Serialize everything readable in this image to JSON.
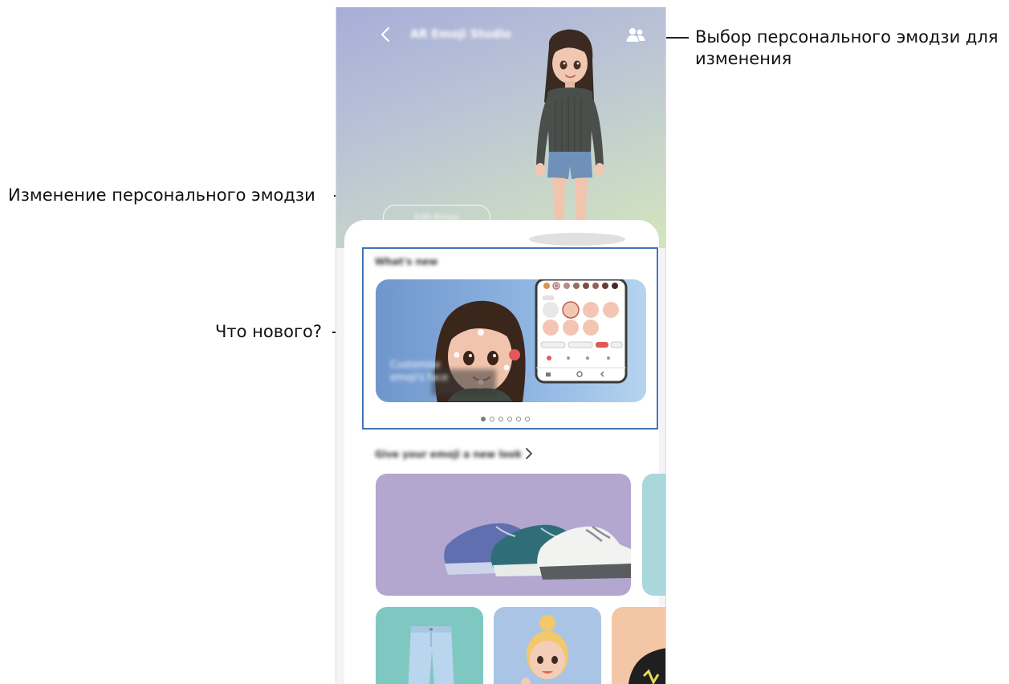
{
  "annotations": {
    "select_emoji_line1": "Выбор персонального эмодзи для",
    "select_emoji_line2": "изменения",
    "edit_emoji": "Изменение персонального эмодзи",
    "whats_new": "Что нового?"
  },
  "app": {
    "title": "AR Emoji Studio",
    "edit_button_label": "Edit Emoji",
    "whats_new_title": "What's new",
    "banner_text_line1": "Customise",
    "banner_text_line2": "emoji's face",
    "new_look_title": "Give your emoji a new look",
    "carousel": {
      "total_pages": 6,
      "active_index": 0
    }
  },
  "icons": {
    "back": "chevron-left-icon",
    "select_emoji": "people-icon",
    "more": "chevron-right-icon"
  },
  "colors": {
    "callout_frame": "#3f74b5",
    "leader_line": "#222222",
    "shoes_card": "#b3a6cf",
    "pants_card": "#7fc8c2",
    "avatar_card": "#aac4e6",
    "hoodie_card": "#f3c7a6"
  }
}
